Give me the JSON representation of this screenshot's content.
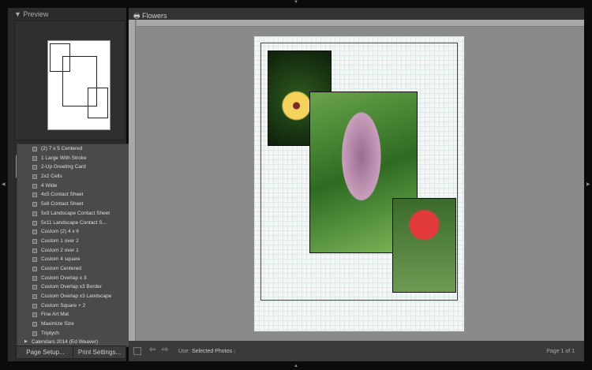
{
  "preview": {
    "title": "Preview"
  },
  "templates": [
    "(2) 7 x 5 Centered",
    "1 Large With Stroke",
    "2-Up Greeting Card",
    "2x2 Cells",
    "4 Wide",
    "4x5 Contact Sheet",
    "5x8 Contact Sheet",
    "5x9 Landscape Contact Sheet",
    "5x11 Landscape Contact S...",
    "Custom (2) 4 x 6",
    "Custom 1 over 2",
    "Custom 2 over 1",
    "Custom 4 square",
    "Custom Centered",
    "Custom Overlap x 3",
    "Custom Overlap x3 Border",
    "Custom Overlap x3 Landscape",
    "Custom Square + 2",
    "Fine Art Mat",
    "Maximize Size",
    "Triptych"
  ],
  "folder": "Calendars 2014 (Ed Weaver)",
  "buttons": {
    "page_setup": "Page Setup...",
    "print_settings": "Print Settings..."
  },
  "main": {
    "title": "Flowers"
  },
  "toolbar": {
    "use_label": "Use:",
    "use_value": "Selected Photos",
    "page": "Page 1 of 1"
  }
}
